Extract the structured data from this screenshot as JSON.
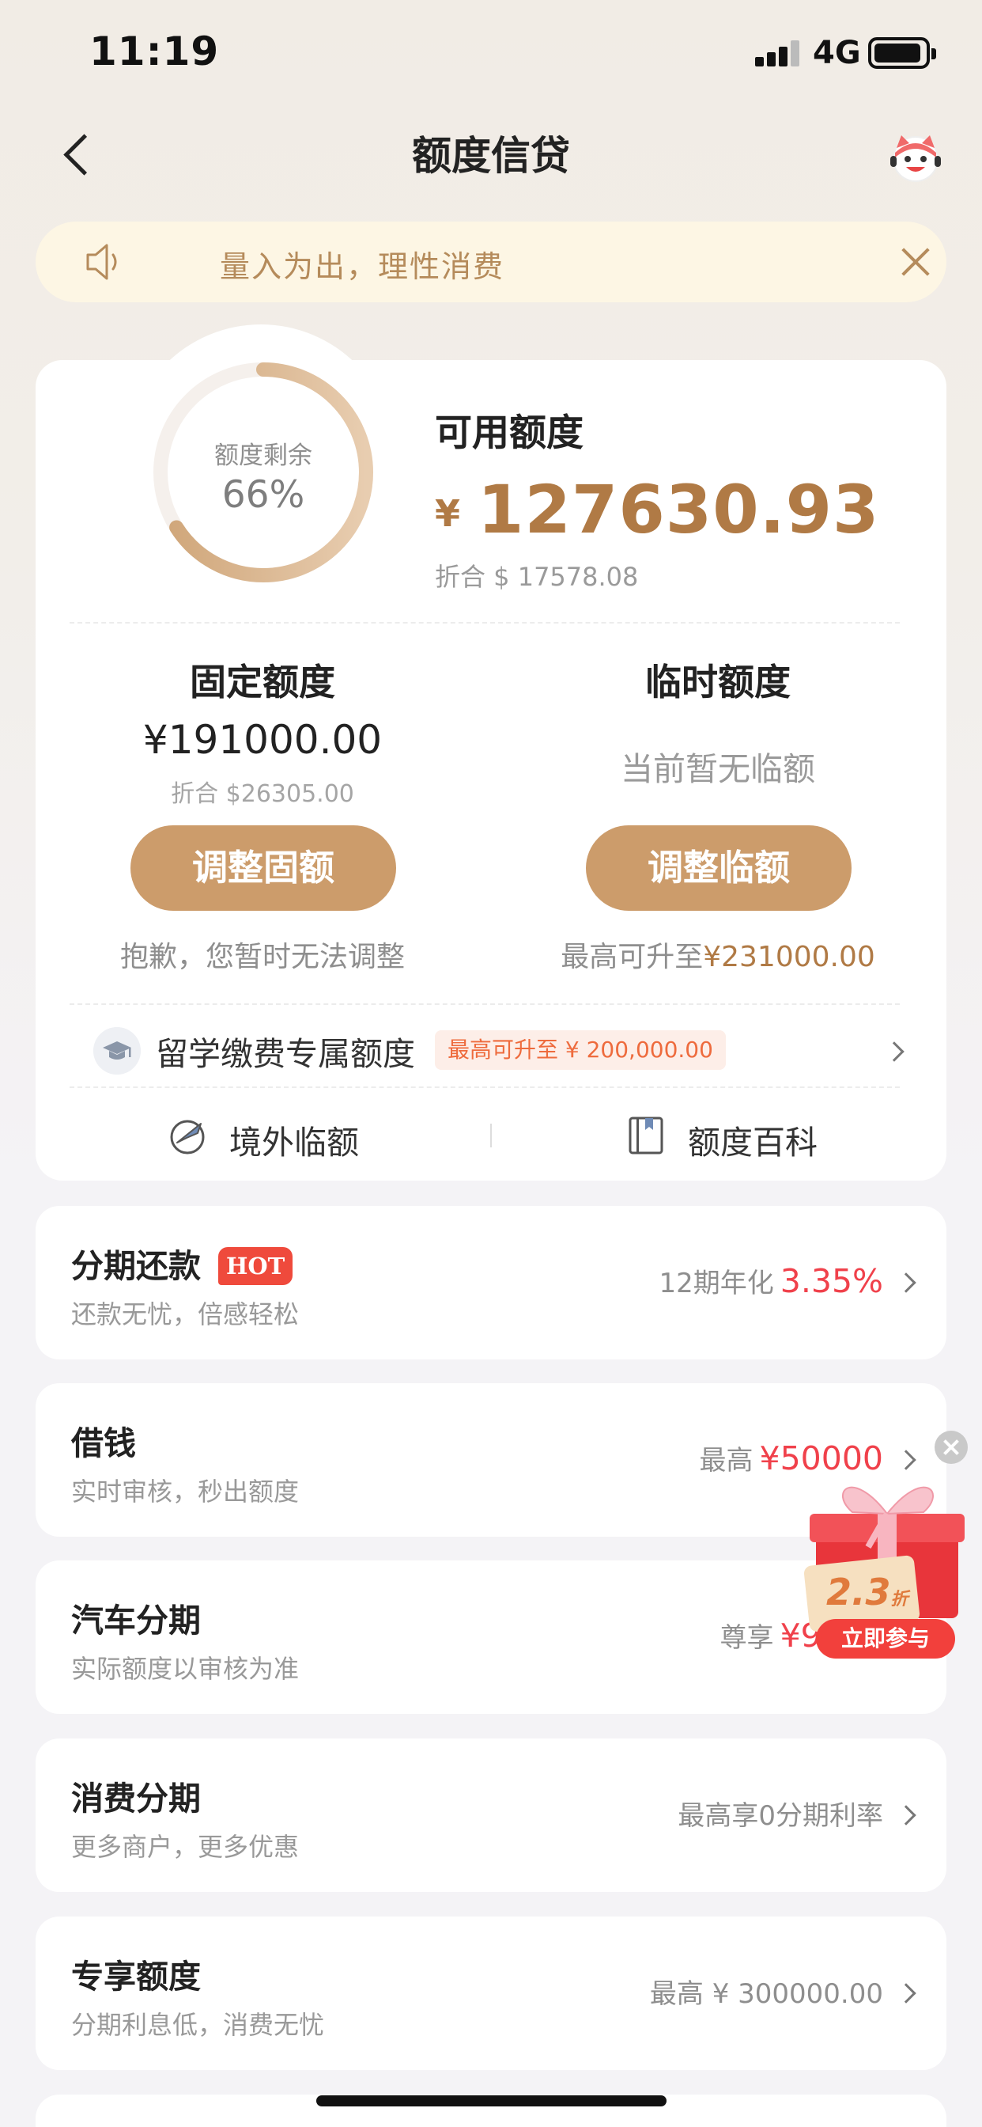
{
  "status_bar": {
    "time": "11:19",
    "network": "4G"
  },
  "nav": {
    "title": "额度信贷",
    "back_icon": "chevron-left-icon",
    "service_icon": "customer-service-mascot-icon"
  },
  "notice": {
    "text": "量入为出，理性消费"
  },
  "credit": {
    "ring_label": "额度剩余",
    "ring_value": "66%",
    "ring_fraction": 0.66,
    "available_title": "可用额度",
    "currency": "¥",
    "available_amount": "127630.93",
    "available_equiv": "折合 $ 17578.08",
    "fixed": {
      "title": "固定额度",
      "amount": "¥191000.00",
      "equiv": "折合 $26305.00",
      "button": "调整固额",
      "note": "抱歉，您暂时无法调整"
    },
    "temp": {
      "title": "临时额度",
      "empty": "当前暂无临额",
      "button": "调整临额",
      "note_prefix": "最高可升至",
      "note_amount": "¥231000.00"
    },
    "study": {
      "title": "留学缴费专属额度",
      "badge": "最高可升至 ¥ 200,000.00"
    },
    "links": {
      "overseas": "境外临额",
      "wiki": "额度百科"
    }
  },
  "list": [
    {
      "title": "分期还款",
      "badge": "HOT",
      "sub": "还款无忧，倍感轻松",
      "right_prefix": "12期年化",
      "right_value": "3.35%"
    },
    {
      "title": "借钱",
      "sub": "实时审核，秒出额度",
      "right_prefix": "最高",
      "right_value": "¥50000"
    },
    {
      "title": "汽车分期",
      "sub": "实际额度以审核为准",
      "right_prefix": "尊享",
      "right_value": "¥9700"
    },
    {
      "title": "消费分期",
      "sub": "更多商户，更多优惠",
      "right_prefix": "最高享0分期利率",
      "right_value": ""
    },
    {
      "title": "专享额度",
      "sub": "分期利息低，消费无忧",
      "right_prefix": "最高 ¥ 300000.00",
      "right_value": ""
    }
  ],
  "promo": {
    "discount": "2.3",
    "discount_unit": "折",
    "button": "立即参与"
  },
  "colors": {
    "accent": "#cc9c6b",
    "gold_text": "#b07a45",
    "red": "#f0414b"
  }
}
